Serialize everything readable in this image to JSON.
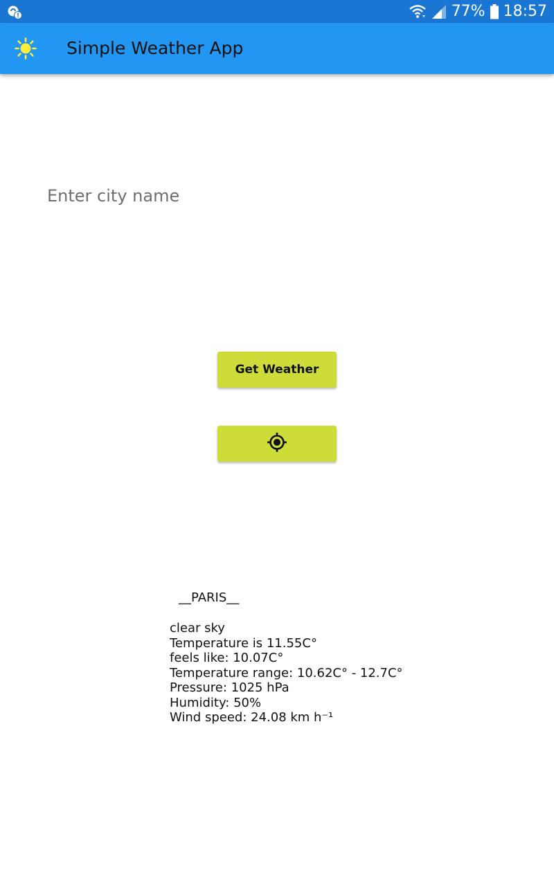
{
  "status_bar": {
    "left_icon": "notification-alert-icon",
    "wifi_icon": "wifi-icon",
    "signal_icon": "signal-icon",
    "battery_percent": "77%",
    "battery_icon": "battery-icon",
    "time": "18:57"
  },
  "app_bar": {
    "icon": "sun-icon",
    "title": "Simple Weather App",
    "background_color": "#2196F3"
  },
  "search": {
    "placeholder": "Enter city name",
    "value": ""
  },
  "buttons": {
    "get_weather_label": "Get Weather",
    "locate_icon": "my-location-icon",
    "color": "#CDDC39"
  },
  "weather": {
    "city": "__PARIS__",
    "lines": [
      "clear sky",
      "Temperature is 11.55C°",
      "feels like: 10.07C°",
      "Temperature range: 10.62C° - 12.7C°",
      "Pressure: 1025 hPa",
      "Humidity: 50%",
      "Wind speed: 24.08 km h⁻¹"
    ]
  }
}
